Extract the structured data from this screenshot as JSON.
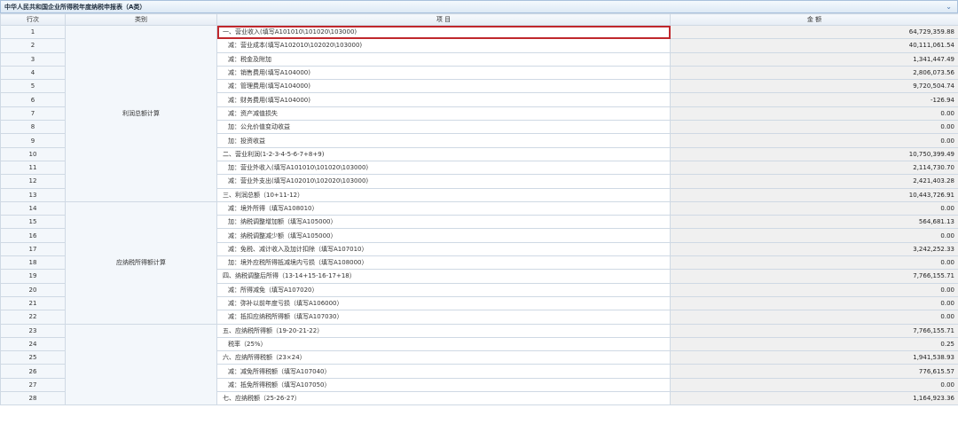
{
  "window": {
    "title": "中华人民共和国企业所得税年度纳税申报表（A类）"
  },
  "table": {
    "headers": {
      "row": "行次",
      "category": "类别",
      "item": "项 目",
      "amount": "金 额"
    },
    "categories": {
      "profit": "利润总额计算",
      "taxable": "应纳税所得额计算"
    },
    "rows": [
      {
        "n": "1",
        "item": "一、营业收入(填写A101010\\101020\\103000)",
        "amount": "64,729,359.88"
      },
      {
        "n": "2",
        "item": "减：营业成本(填写A102010\\102020\\103000)",
        "amount": "40,111,061.54"
      },
      {
        "n": "3",
        "item": "减：税金及附加",
        "amount": "1,341,447.49"
      },
      {
        "n": "4",
        "item": "减：销售费用(填写A104000)",
        "amount": "2,806,073.56"
      },
      {
        "n": "5",
        "item": "减：管理费用(填写A104000)",
        "amount": "9,720,504.74"
      },
      {
        "n": "6",
        "item": "减：财务费用(填写A104000)",
        "amount": "-126.94"
      },
      {
        "n": "7",
        "item": "减：资产减值损失",
        "amount": "0.00"
      },
      {
        "n": "8",
        "item": "加：公允价值变动收益",
        "amount": "0.00"
      },
      {
        "n": "9",
        "item": "加：投资收益",
        "amount": "0.00"
      },
      {
        "n": "10",
        "item": "二、营业利润(1-2-3-4-5-6-7+8+9)",
        "amount": "10,750,399.49"
      },
      {
        "n": "11",
        "item": "加：营业外收入(填写A101010\\101020\\103000)",
        "amount": "2,114,730.70"
      },
      {
        "n": "12",
        "item": "减：营业外支出(填写A102010\\102020\\103000)",
        "amount": "2,421,403.28"
      },
      {
        "n": "13",
        "item": "三、利润总额（10+11-12）",
        "amount": "10,443,726.91"
      },
      {
        "n": "14",
        "item": "减：境外所得（填写A108010）",
        "amount": "0.00"
      },
      {
        "n": "15",
        "item": "加：纳税调整增加额（填写A105000）",
        "amount": "564,681.13"
      },
      {
        "n": "16",
        "item": "减：纳税调整减少额（填写A105000）",
        "amount": "0.00"
      },
      {
        "n": "17",
        "item": "减：免税、减计收入及加计扣除（填写A107010）",
        "amount": "3,242,252.33"
      },
      {
        "n": "18",
        "item": "加：境外应税所得抵减境内亏损（填写A108000）",
        "amount": "0.00"
      },
      {
        "n": "19",
        "item": "四、纳税调整后所得（13-14+15-16-17+18）",
        "amount": "7,766,155.71"
      },
      {
        "n": "20",
        "item": "减：所得减免（填写A107020）",
        "amount": "0.00"
      },
      {
        "n": "21",
        "item": "减：弥补以前年度亏损（填写A106000）",
        "amount": "0.00"
      },
      {
        "n": "22",
        "item": "减：抵扣应纳税所得额（填写A107030）",
        "amount": "0.00"
      },
      {
        "n": "23",
        "item": "五、应纳税所得额（19-20-21-22）",
        "amount": "7,766,155.71"
      },
      {
        "n": "24",
        "item": "税率（25%）",
        "amount": "0.25"
      },
      {
        "n": "25",
        "item": "六、应纳所得税额（23×24）",
        "amount": "1,941,538.93"
      },
      {
        "n": "26",
        "item": "减：减免所得税额（填写A107040）",
        "amount": "776,615.57"
      },
      {
        "n": "27",
        "item": "减：抵免所得税额（填写A107050）",
        "amount": "0.00"
      },
      {
        "n": "28",
        "item": "七、应纳税额（25-26-27）",
        "amount": "1,164,923.36"
      }
    ]
  },
  "icons": {
    "collapse": "chevron-down-icon"
  },
  "colors": {
    "highlight": "#c0282d",
    "header_bg": "#e6edf5"
  }
}
